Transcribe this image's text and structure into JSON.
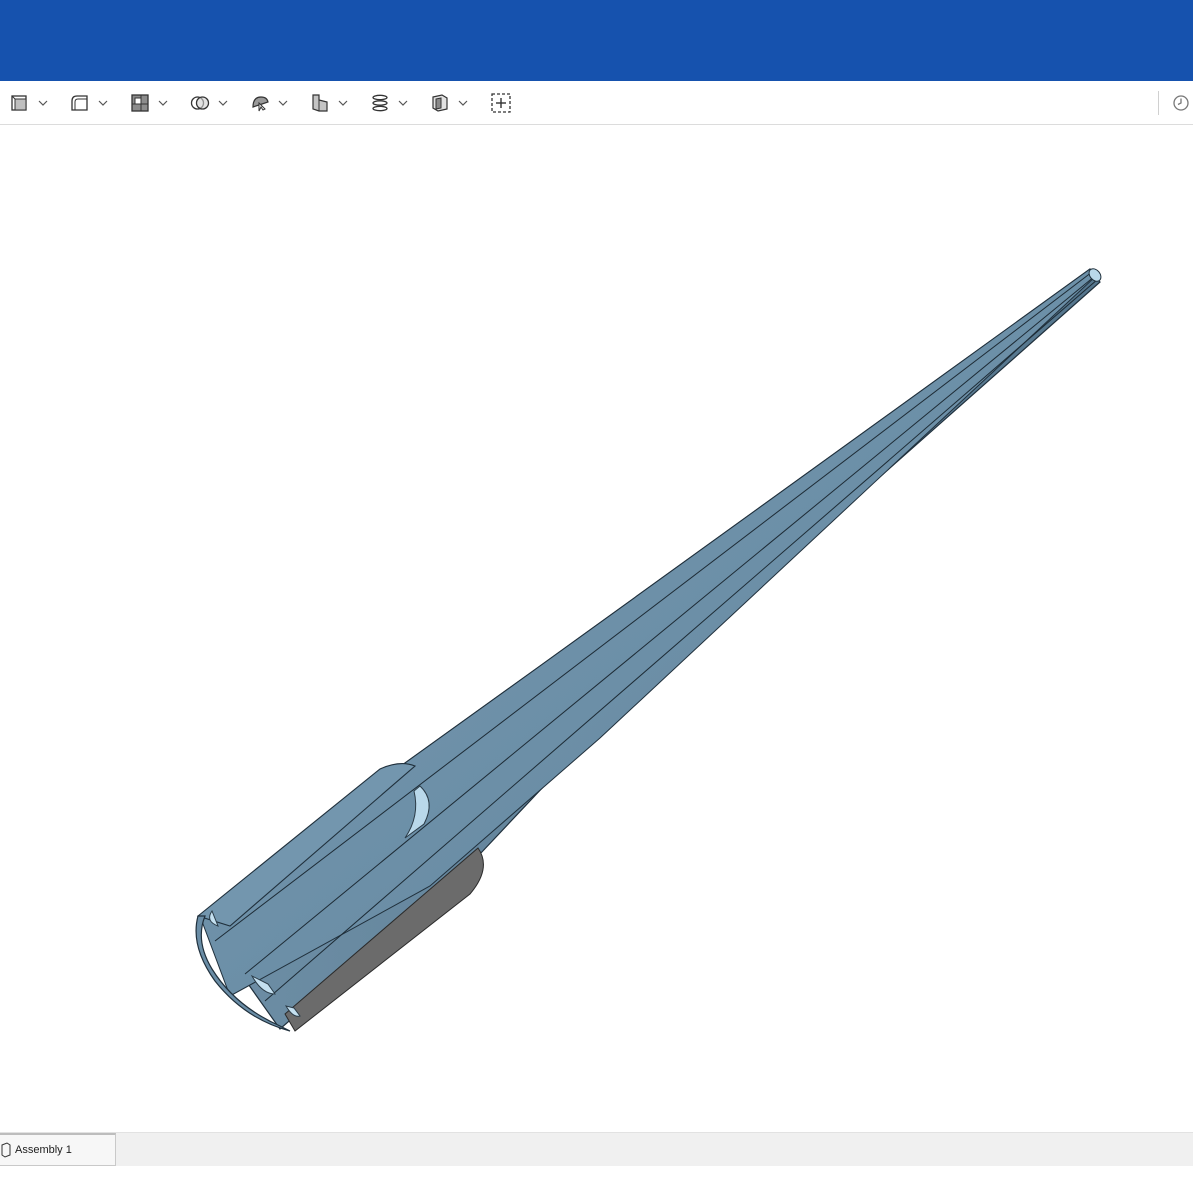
{
  "header": {
    "color": "#1652ae"
  },
  "toolbar": {
    "tools": [
      {
        "icon": "extrude-icon"
      },
      {
        "icon": "fillet-icon"
      },
      {
        "icon": "shell-icon"
      },
      {
        "icon": "boolean-icon"
      },
      {
        "icon": "transform-icon"
      },
      {
        "icon": "plane-icon"
      },
      {
        "icon": "helix-icon"
      },
      {
        "icon": "part-studio-icon"
      }
    ],
    "extra_icon": "add-feature-icon",
    "history_icon": "history-clock-icon"
  },
  "model": {
    "color": "#6a8da6"
  },
  "tabs": [
    {
      "label": "Assembly 1",
      "icon": "assembly-icon"
    }
  ]
}
